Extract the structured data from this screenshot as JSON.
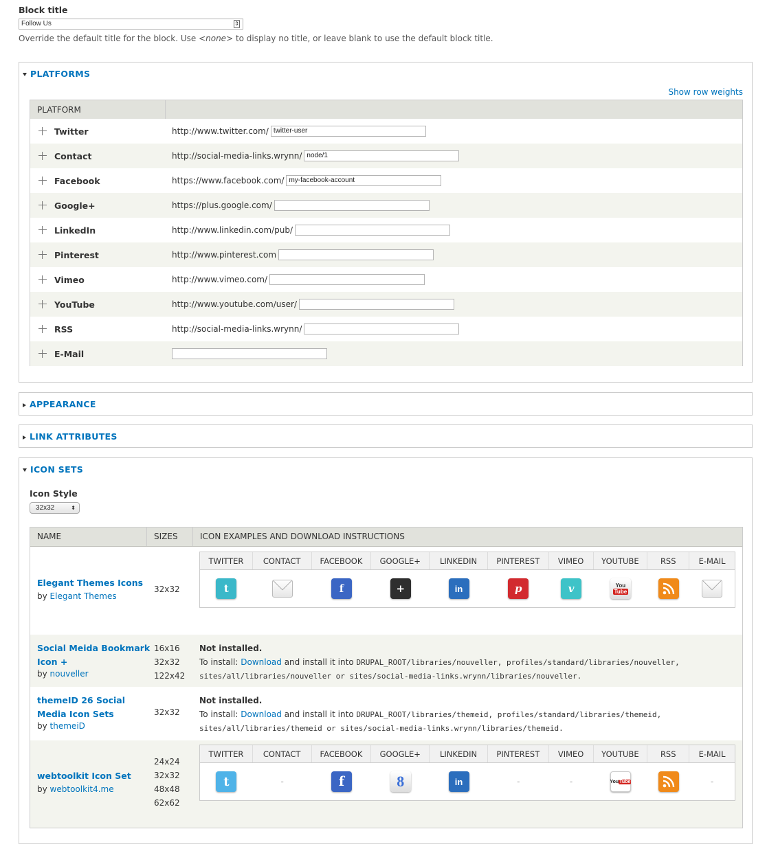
{
  "block_title": {
    "label": "Block title",
    "value": "Follow Us",
    "description_pre": "Override the default title for the block. Use ",
    "description_em": "<none>",
    "description_post": " to display no title, or leave blank to use the default block title."
  },
  "platforms": {
    "legend": "PLATFORMS",
    "show_weights": "Show row weights",
    "col_platform": "PLATFORM",
    "rows": [
      {
        "name": "Twitter",
        "prefix": "http://www.twitter.com/",
        "value": "twitter-user"
      },
      {
        "name": "Contact",
        "prefix": "http://social-media-links.wrynn/",
        "value": "node/1"
      },
      {
        "name": "Facebook",
        "prefix": "https://www.facebook.com/",
        "value": "my-facebook-account"
      },
      {
        "name": "Google+",
        "prefix": "https://plus.google.com/",
        "value": ""
      },
      {
        "name": "LinkedIn",
        "prefix": "http://www.linkedin.com/pub/",
        "value": ""
      },
      {
        "name": "Pinterest",
        "prefix": "http://www.pinterest.com",
        "value": ""
      },
      {
        "name": "Vimeo",
        "prefix": "http://www.vimeo.com/",
        "value": ""
      },
      {
        "name": "YouTube",
        "prefix": "http://www.youtube.com/user/",
        "value": ""
      },
      {
        "name": "RSS",
        "prefix": "http://social-media-links.wrynn/",
        "value": ""
      },
      {
        "name": "E-Mail",
        "prefix": "",
        "value": ""
      }
    ]
  },
  "appearance": {
    "legend": "APPEARANCE"
  },
  "link_attributes": {
    "legend": "LINK ATTRIBUTES"
  },
  "icon_sets": {
    "legend": "ICON SETS",
    "style_label": "Icon Style",
    "style_value": "32x32",
    "col_name": "NAME",
    "col_sizes": "SIZES",
    "col_examples": "ICON EXAMPLES AND DOWNLOAD INSTRUCTIONS",
    "icon_headers": [
      "TWITTER",
      "CONTACT",
      "FACEBOOK",
      "GOOGLE+",
      "LINKEDIN",
      "PINTEREST",
      "VIMEO",
      "YOUTUBE",
      "RSS",
      "E-MAIL"
    ],
    "by": "by ",
    "set1": {
      "name": "Elegant Themes Icons",
      "author": "Elegant Themes",
      "sizes": "32x32"
    },
    "set2": {
      "name_line1": "Social Meida Bookmark",
      "name_line2": "Icon +",
      "author": "nouveller",
      "sizes": [
        "16x16",
        "32x32",
        "122x42"
      ],
      "status": "Not installed.",
      "install_pre": "To install: ",
      "download": "Download",
      "install_mid": " and install it into ",
      "path_line1": "DRUPAL_ROOT/libraries/nouveller, profiles/standard/libraries/nouveller,",
      "path_line2": "sites/all/libraries/nouveller or sites/social-media-links.wrynn/libraries/nouveller."
    },
    "set3": {
      "name_line1": "themeID 26 Social",
      "name_line2": "Media Icon Sets",
      "author": "themeiD",
      "sizes": "32x32",
      "status": "Not installed.",
      "install_pre": "To install: ",
      "download": "Download",
      "install_mid": " and install it into ",
      "path_line1": "DRUPAL_ROOT/libraries/themeid, profiles/standard/libraries/themeid,",
      "path_line2": "sites/all/libraries/themeid or sites/social-media-links.wrynn/libraries/themeid."
    },
    "set4": {
      "name": "webtoolkit Icon Set",
      "author": "webtoolkit4.me",
      "sizes": [
        "24x24",
        "32x32",
        "48x48",
        "62x62"
      ],
      "dash": "-"
    },
    "icon_glyphs": {
      "twitter": "t",
      "facebook": "f",
      "googleplus": "+",
      "linkedin": "in",
      "pinterest": "p",
      "vimeo": "v",
      "youtube": "You\nTube",
      "google_g": "8"
    },
    "colors": {
      "twitter": "#3bb8c9",
      "facebook": "#3b66c4",
      "googleplus": "#2e2e2e",
      "linkedin": "#2b6ebd",
      "pinterest": "#d22a2f",
      "vimeo": "#3ec3c8",
      "youtube": "#d3241f",
      "rss": "#f08a1a",
      "link": "#0074bd"
    }
  }
}
